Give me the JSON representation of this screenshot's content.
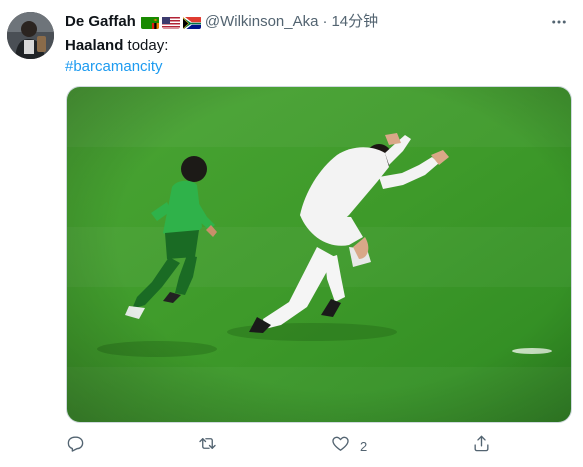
{
  "tweet": {
    "author": {
      "display_name": "De Gaffah",
      "flags": [
        "zambia-flag-icon",
        "usa-flag-icon",
        "south-africa-flag-icon"
      ],
      "handle": "@Wilkinson_Aka",
      "separator": "·",
      "time": "14分钟"
    },
    "text": {
      "bold_name": "Haaland",
      "rest": " today:",
      "hashtag": "#barcamancity"
    },
    "actions": {
      "reply_icon": "reply-icon",
      "retweet_icon": "retweet-icon",
      "like_icon": "heart-icon",
      "like_count": "2",
      "share_icon": "share-icon"
    },
    "more_icon": "more-dots-icon"
  },
  "colors": {
    "accent": "#1d9bf0",
    "secondary_text": "#536471",
    "pitch_green": "#3e9a2a"
  }
}
